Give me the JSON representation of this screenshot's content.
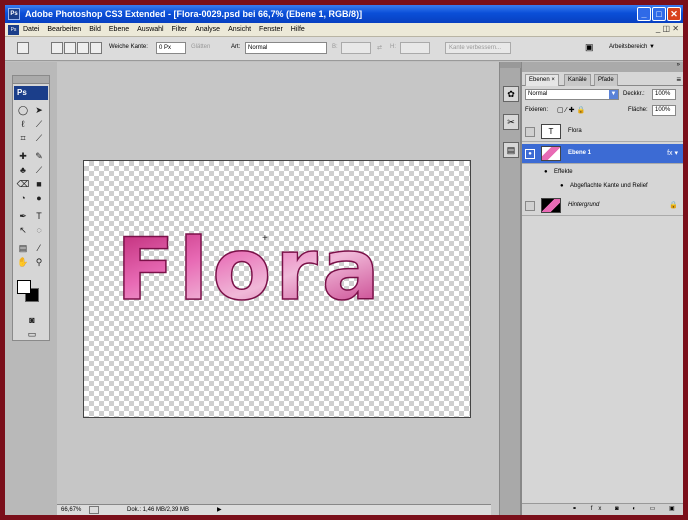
{
  "window": {
    "title": "Adobe Photoshop CS3 Extended - [Flora-0029.psd bei 66,7% (Ebene 1, RGB/8)]",
    "controls": {
      "minimize": "_",
      "maximize": "□",
      "close": "✕"
    },
    "app_icon": "Ps"
  },
  "menubar": {
    "items": [
      "Datei",
      "Bearbeiten",
      "Bild",
      "Ebene",
      "Auswahl",
      "Filter",
      "Analyse",
      "Ansicht",
      "Fenster",
      "Hilfe"
    ],
    "right_controls": "_ ◫ ✕"
  },
  "optionsbar": {
    "weiche_kante_label": "Weiche Kante:",
    "weiche_kante_value": "0 Px",
    "glaetten_label": "Glätten",
    "art_label": "Art:",
    "art_value": "Normal",
    "b_label": "B:",
    "h_label": "H:",
    "kante_button": "Kante verbessern...",
    "arbeitsbereich": "Arbeitsbereich ▼"
  },
  "toolbox": {
    "logo": "Ps"
  },
  "canvas": {
    "text": "Flora",
    "text_color": "#d94aa0"
  },
  "statusbar": {
    "zoom": "66,67%",
    "doc": "Dok.: 1,46 MB/2,39 MB"
  },
  "layers_panel": {
    "tabs": [
      "Ebenen ×",
      "Kanäle",
      "Pfade"
    ],
    "panel_menu": "≡",
    "blend_mode": "Normal",
    "deckkraft_label": "Deckkr.:",
    "deckkraft_value": "100%",
    "fixieren_label": "Fixieren:",
    "flaeche_label": "Fläche:",
    "flaeche_value": "100%",
    "layers": [
      {
        "name": "Flora",
        "thumb": "T"
      },
      {
        "name": "Ebene 1",
        "thumb": "img",
        "fx": "fx ▾"
      },
      {
        "name": "Hintergrund",
        "thumb": "img",
        "lock": "🔒"
      }
    ],
    "effects_label": "Effekte",
    "effect_item": "Abgeflachte Kante und Relief",
    "bottom_icons": "⚭ fx ◙ ◐ ▭ ▣ 🗑"
  },
  "colors": {
    "accent": "#3c6bd4",
    "titlebar": "#0a4fd8",
    "outer_border": "#7a0f1a"
  }
}
